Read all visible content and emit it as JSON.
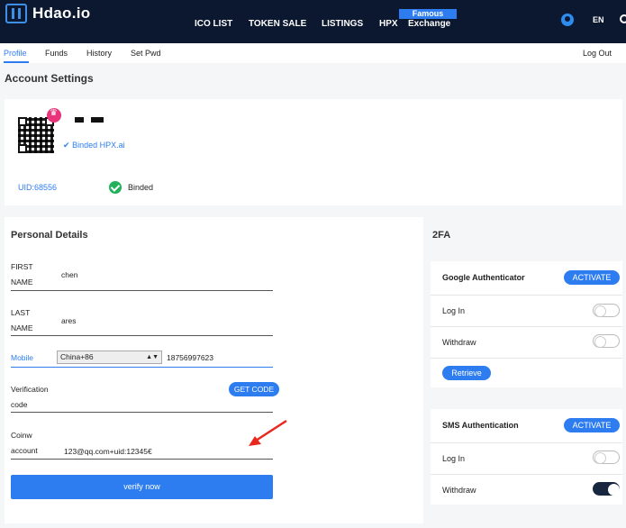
{
  "header": {
    "logo_text": "Hdao.io",
    "nav": [
      "ICO LIST",
      "TOKEN SALE",
      "LISTINGS",
      "HPX",
      "Exchange"
    ],
    "famous_badge": "Famous",
    "lang": "EN"
  },
  "subnav": {
    "items": [
      "Profile",
      "Funds",
      "History",
      "Set Pwd"
    ],
    "logout": "Log Out"
  },
  "page_title": "Account Settings",
  "account": {
    "binded_link": "Binded HPX.ai",
    "uid": "UID:68556",
    "status": "Binded"
  },
  "personal": {
    "title": "Personal Details",
    "first_label_1": "FIRST",
    "first_label_2": "NAME",
    "first_value": "chen",
    "last_label_1": "LAST",
    "last_label_2": "NAME",
    "last_value": "ares",
    "mobile_label": "Mobile",
    "country": "China+86",
    "mobile_value": "18756997623",
    "verif_label_1": "Verification",
    "verif_label_2": "code",
    "get_code": "GET CODE",
    "coinw_label_1": "Coinw",
    "coinw_label_2": "account",
    "coinw_value": "123@qq.com+uid:12345€",
    "verify_btn": "verify now"
  },
  "twofa": {
    "title": "2FA",
    "google": {
      "title": "Google Authenticator",
      "activate": "ACTIVATE",
      "login": "Log In",
      "withdraw": "Withdraw",
      "retrieve": "Retrieve"
    },
    "sms": {
      "title": "SMS Authentication",
      "activate": "ACTIVATE",
      "login": "Log In",
      "withdraw": "Withdraw"
    }
  },
  "colors": {
    "header_bg": "#0b1830",
    "accent": "#2d7df0",
    "success": "#20b15a",
    "annotation_arrow": "#e8281e"
  }
}
